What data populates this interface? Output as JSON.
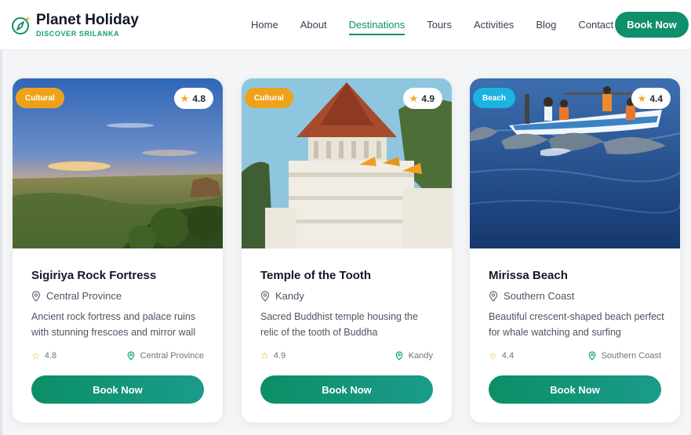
{
  "brand": {
    "name": "Planet Holiday",
    "tagline": "DISCOVER SRILANKA"
  },
  "nav": {
    "items": [
      "Home",
      "About",
      "Destinations",
      "Tours",
      "Activities",
      "Blog",
      "Contact"
    ],
    "active": "Destinations",
    "cta": "Book Now"
  },
  "colors": {
    "accent": "#0e8f6e",
    "cultural_badge": "#eea21b",
    "beach_badge": "#1cb3e0",
    "star": "#f5a623"
  },
  "cards": [
    {
      "badge": "Cultural",
      "rating": "4.8",
      "title": "Sigiriya Rock Fortress",
      "location": "Central Province",
      "description": "Ancient rock fortress and palace ruins with stunning frescoes and mirror wall",
      "button": "Book Now"
    },
    {
      "badge": "Cultural",
      "rating": "4.9",
      "title": "Temple of the Tooth",
      "location": "Kandy",
      "description": "Sacred Buddhist temple housing the relic of the tooth of Buddha",
      "button": "Book Now"
    },
    {
      "badge": "Beach",
      "rating": "4.4",
      "title": "Mirissa Beach",
      "location": "Southern Coast",
      "description": "Beautiful crescent-shaped beach perfect for whale watching and surfing",
      "button": "Book Now"
    }
  ]
}
